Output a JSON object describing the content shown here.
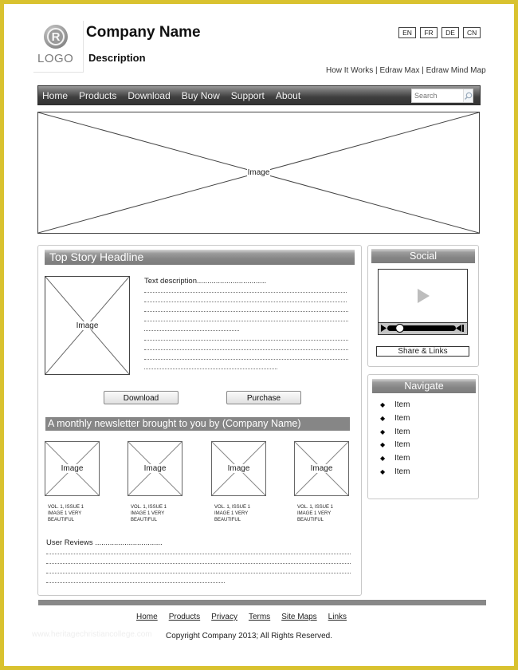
{
  "header": {
    "logo_text": "LOGO",
    "logo_mark": "R",
    "company_name": "Company Name",
    "description": "Description",
    "languages": [
      "EN",
      "FR",
      "DE",
      "CN"
    ],
    "top_links": [
      "How It Works",
      "Edraw Max",
      "Edraw Mind Map"
    ],
    "top_link_separator": " | "
  },
  "nav": {
    "items": [
      "Home",
      "Products",
      "Download",
      "Buy Now",
      "Support",
      "About"
    ],
    "search_placeholder": "Search",
    "search_icon": "magnifier-icon"
  },
  "banner": {
    "label": "Image"
  },
  "main": {
    "headline": "Top Story Headline",
    "story_image_label": "Image",
    "text_description": "Text description.................................",
    "buttons": {
      "download": "Download",
      "purchase": "Purchase"
    },
    "newsletter_title": "A monthly newsletter brought to you by (Company Name)",
    "thumbnails": [
      {
        "label": "Image",
        "caption": [
          "VOL. 1, ISSUE 1",
          "IMAGE 1 VERY",
          "BEAUTIFUL"
        ]
      },
      {
        "label": "Image",
        "caption": [
          "VOL. 1, ISSUE 1",
          "IMAGE 1 VERY",
          "BEAUTIFUL"
        ]
      },
      {
        "label": "Image",
        "caption": [
          "VOL. 1, ISSUE 1",
          "IMAGE 1 VERY",
          "BEAUTIFUL"
        ]
      },
      {
        "label": "Image",
        "caption": [
          "VOL. 1, ISSUE 1",
          "IMAGE 1 VERY",
          "BEAUTIFUL"
        ]
      }
    ],
    "user_reviews_label": "User Reviews ................................"
  },
  "sidebar": {
    "social": {
      "title": "Social",
      "video_progress": 0.15,
      "share_label": "Share & Links"
    },
    "navigate": {
      "title": "Navigate",
      "items": [
        "Item",
        "Item",
        "Item",
        "Item",
        "Item",
        "Item"
      ]
    }
  },
  "footer": {
    "links": [
      "Home",
      "Products",
      "Privacy",
      "Terms",
      "Site Maps",
      "Links"
    ],
    "copyright": "Copyright Company 2013; All Rights Reserved.",
    "watermark": "www.heritagechristiancollege.com"
  },
  "colors": {
    "frame": "#d9c22f",
    "nav_dark": "#3e3e3e",
    "header_bar_gray": "#868686",
    "footer_bar": "#888888"
  }
}
